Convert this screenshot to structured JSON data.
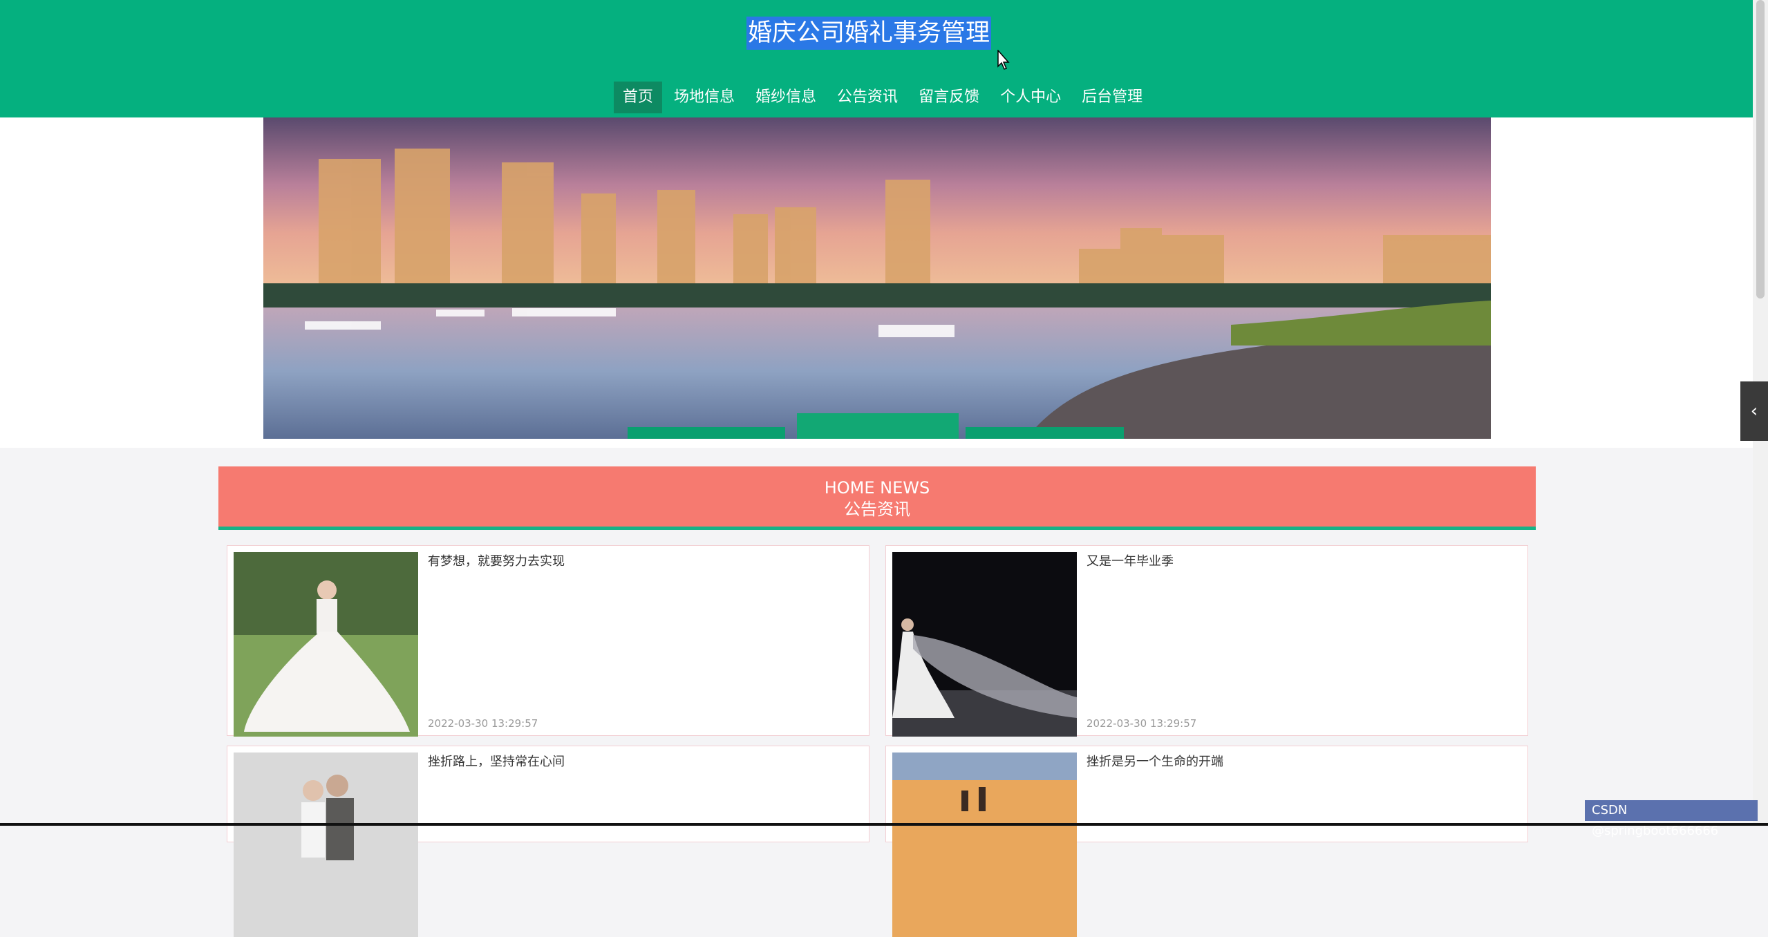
{
  "header": {
    "title": "婚庆公司婚礼事务管理",
    "nav": [
      {
        "label": "首页",
        "active": true
      },
      {
        "label": "场地信息"
      },
      {
        "label": "婚纱信息"
      },
      {
        "label": "公告资讯"
      },
      {
        "label": "留言反馈"
      },
      {
        "label": "个人中心"
      },
      {
        "label": "后台管理"
      }
    ]
  },
  "section": {
    "title_en": "HOME NEWS",
    "title_cn": "公告资讯"
  },
  "news": [
    {
      "title": "有梦想，就要努力去实现",
      "date": "2022-03-30 13:29:57"
    },
    {
      "title": "又是一年毕业季",
      "date": "2022-03-30 13:29:57"
    },
    {
      "title": "挫折路上，坚持常在心间"
    },
    {
      "title": "挫折是另一个生命的开端"
    }
  ],
  "side_toggle": {
    "icon": "chevron-left-icon",
    "glyph": "‹"
  },
  "watermark": "CSDN @springboot666666",
  "colors": {
    "header": "#05b07f",
    "section": "#f67a70",
    "accent": "#17b287"
  }
}
